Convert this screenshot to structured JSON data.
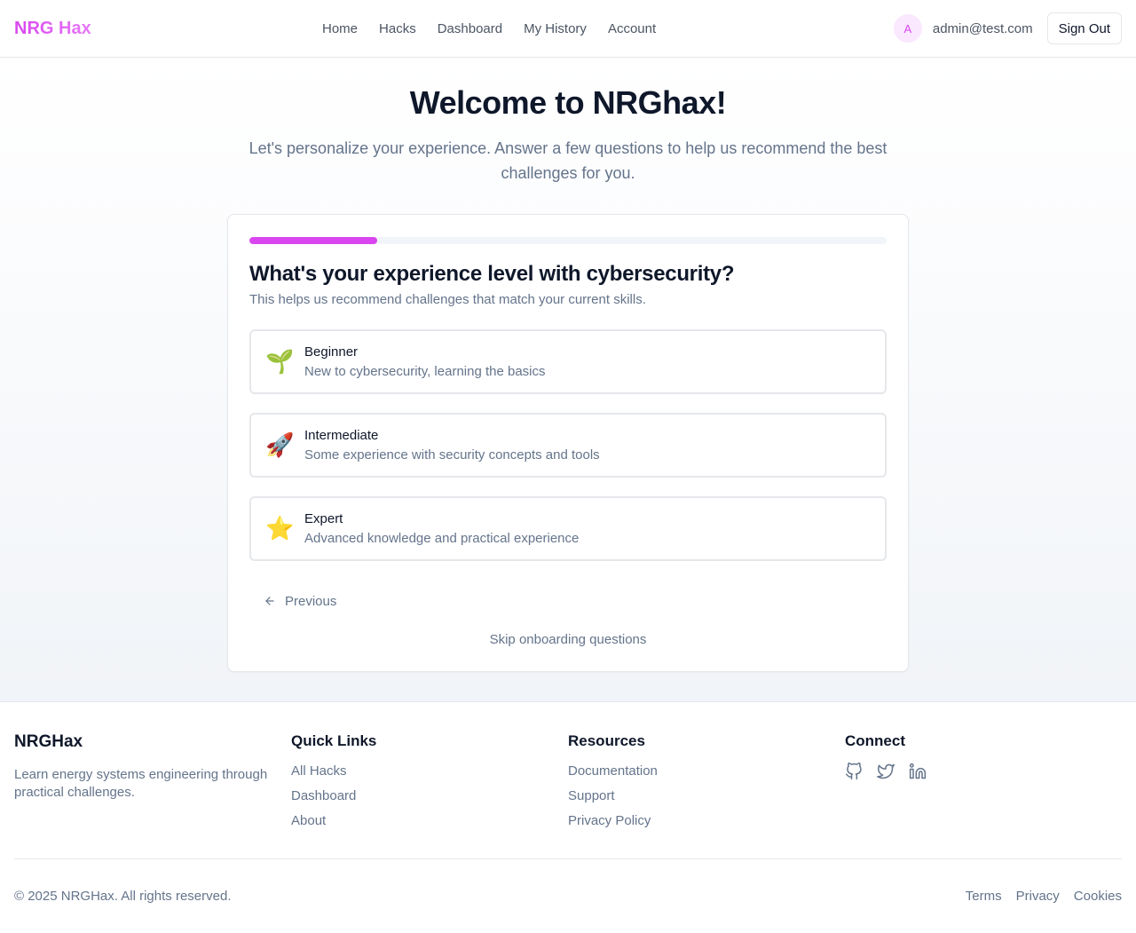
{
  "header": {
    "logo": "NRG Hax",
    "nav": [
      "Home",
      "Hacks",
      "Dashboard",
      "My History",
      "Account"
    ],
    "avatar_initial": "A",
    "user_email": "admin@test.com",
    "sign_out_label": "Sign Out"
  },
  "onboarding": {
    "title": "Welcome to NRGhax!",
    "subtitle": "Let's personalize your experience. Answer a few questions to help us recommend the best challenges for you.",
    "progress_fraction": 0.2,
    "question": "What's your experience level with cybersecurity?",
    "question_help": "This helps us recommend challenges that match your current skills.",
    "options": [
      {
        "icon": "seedling-icon",
        "emoji": "🌱",
        "title": "Beginner",
        "description": "New to cybersecurity, learning the basics"
      },
      {
        "icon": "rocket-icon",
        "emoji": "🚀",
        "title": "Intermediate",
        "description": "Some experience with security concepts and tools"
      },
      {
        "icon": "star-icon",
        "emoji": "⭐",
        "title": "Expert",
        "description": "Advanced knowledge and practical experience"
      }
    ],
    "previous_label": "Previous",
    "skip_label": "Skip onboarding questions"
  },
  "footer": {
    "brand": "NRGHax",
    "tagline": "Learn energy systems engineering through practical challenges.",
    "quick_links": {
      "heading": "Quick Links",
      "links": [
        "All Hacks",
        "Dashboard",
        "About"
      ]
    },
    "resources": {
      "heading": "Resources",
      "links": [
        "Documentation",
        "Support",
        "Privacy Policy"
      ]
    },
    "connect": {
      "heading": "Connect",
      "icons": [
        "github-icon",
        "twitter-icon",
        "linkedin-icon"
      ]
    },
    "copyright": "© 2025 NRGHax. All rights reserved.",
    "legal_links": [
      "Terms",
      "Privacy",
      "Cookies"
    ]
  },
  "colors": {
    "accent": "#d946ef",
    "muted_text": "#64748b",
    "border": "#e5e7eb"
  }
}
